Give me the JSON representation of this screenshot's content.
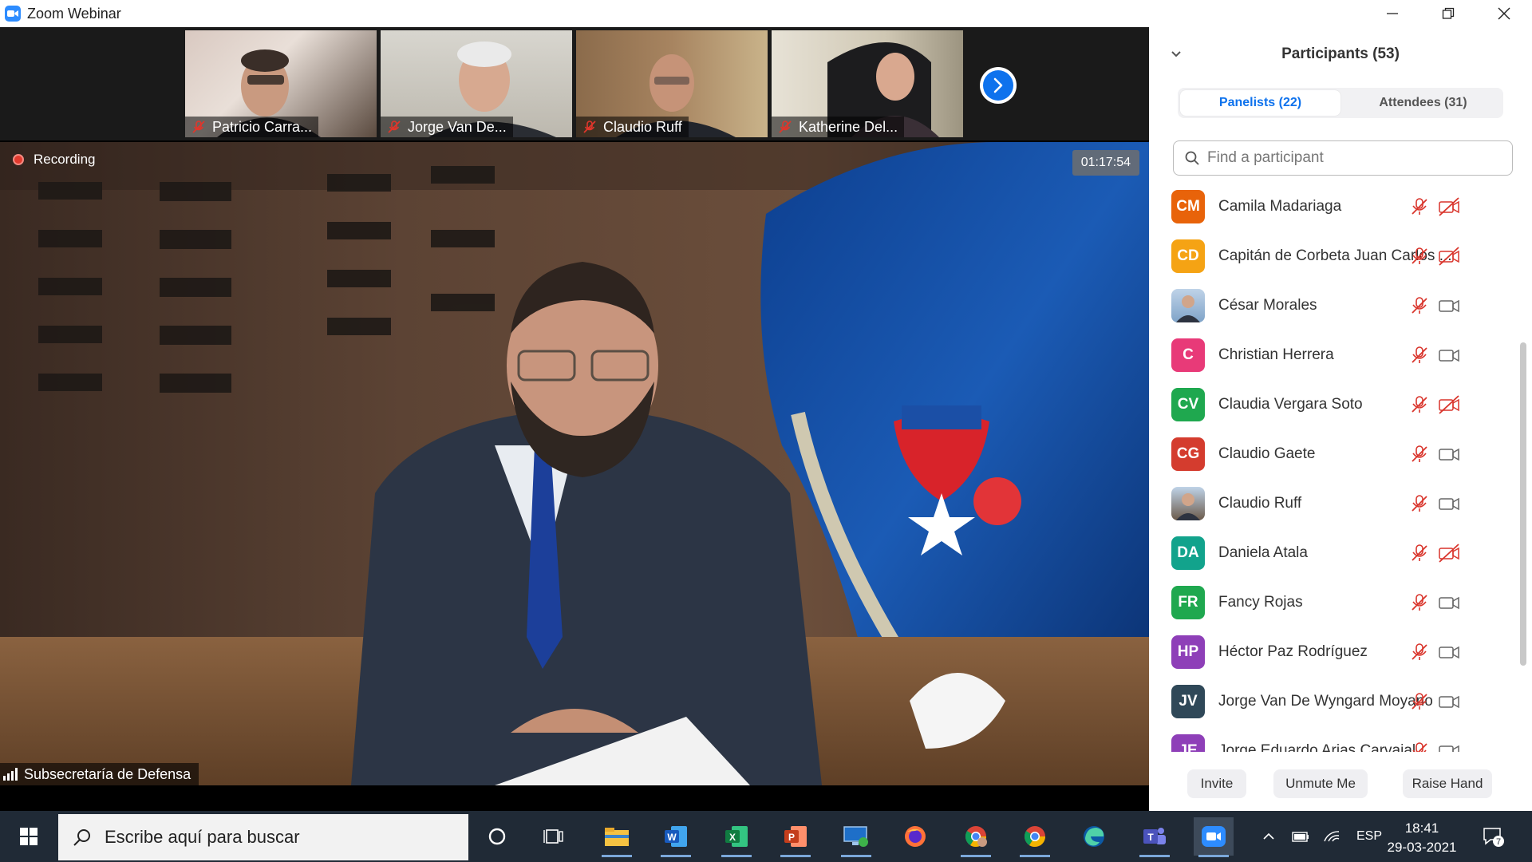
{
  "window": {
    "title": "Zoom Webinar",
    "minimize_icon": "minimize-icon",
    "restore_icon": "restore-icon",
    "close_icon": "close-icon"
  },
  "thumbnails": [
    {
      "name": "Patricio Carra...",
      "muted": true
    },
    {
      "name": "Jorge  Van De...",
      "muted": true
    },
    {
      "name": "Claudio Ruff",
      "muted": true
    },
    {
      "name": "Katherine Del...",
      "muted": true
    }
  ],
  "main_video": {
    "recording_label": "Recording",
    "timer": "01:17:54",
    "speaker_name": "Subsecretaría de Defensa"
  },
  "panel": {
    "title": "Participants (53)",
    "tabs": [
      {
        "label": "Panelists (22)",
        "active": true
      },
      {
        "label": "Attendees (31)",
        "active": false
      }
    ],
    "search_placeholder": "Find a participant",
    "participants": [
      {
        "initials": "CM",
        "name": "Camila Madariaga",
        "color": "#e8630a",
        "photo": false,
        "video_off": true
      },
      {
        "initials": "CD",
        "name": "Capitán de Corbeta Juan Carlos ...",
        "color": "#f5a314",
        "photo": false,
        "video_off": true
      },
      {
        "initials": "",
        "name": "César Morales",
        "color": "#7fa3c8",
        "photo": true,
        "video_off": false
      },
      {
        "initials": "C",
        "name": "Christian Herrera",
        "color": "#e83a78",
        "photo": false,
        "video_off": false
      },
      {
        "initials": "CV",
        "name": "Claudia Vergara Soto",
        "color": "#1fa84f",
        "photo": false,
        "video_off": true
      },
      {
        "initials": "CG",
        "name": "Claudio Gaete",
        "color": "#d43c2e",
        "photo": false,
        "video_off": false
      },
      {
        "initials": "",
        "name": "Claudio Ruff",
        "color": "#6b5a4a",
        "photo": true,
        "video_off": false
      },
      {
        "initials": "DA",
        "name": "Daniela Atala",
        "color": "#12a38c",
        "photo": false,
        "video_off": true
      },
      {
        "initials": "FR",
        "name": "Fancy Rojas",
        "color": "#1fa84f",
        "photo": false,
        "video_off": false
      },
      {
        "initials": "HP",
        "name": "Héctor Paz Rodríguez",
        "color": "#8e3fb8",
        "photo": false,
        "video_off": false
      },
      {
        "initials": "JV",
        "name": "Jorge  Van De Wyngard Moyano",
        "color": "#2f4858",
        "photo": false,
        "video_off": false
      },
      {
        "initials": "JE",
        "name": "Jorge Eduardo Arias Carvajal",
        "color": "#8e3fb8",
        "photo": false,
        "video_off": false
      }
    ],
    "buttons": {
      "invite": "Invite",
      "unmute": "Unmute Me",
      "raise_hand": "Raise Hand"
    }
  },
  "taskbar": {
    "search_placeholder": "Escribe aquí para buscar",
    "language": "ESP",
    "time": "18:41",
    "date": "29-03-2021",
    "notification_count": "7",
    "apps": [
      "task-view-icon",
      "file-explorer-icon",
      "word-icon",
      "excel-icon",
      "powerpoint-icon",
      "remote-desktop-icon",
      "firefox-icon",
      "chrome-profile-icon",
      "chrome-icon",
      "edge-icon",
      "teams-icon",
      "zoom-icon"
    ]
  },
  "colors": {
    "accent": "#0e72ed",
    "recording": "#e23a2e",
    "muted_red": "#d9342b",
    "taskbar": "#202a36"
  }
}
